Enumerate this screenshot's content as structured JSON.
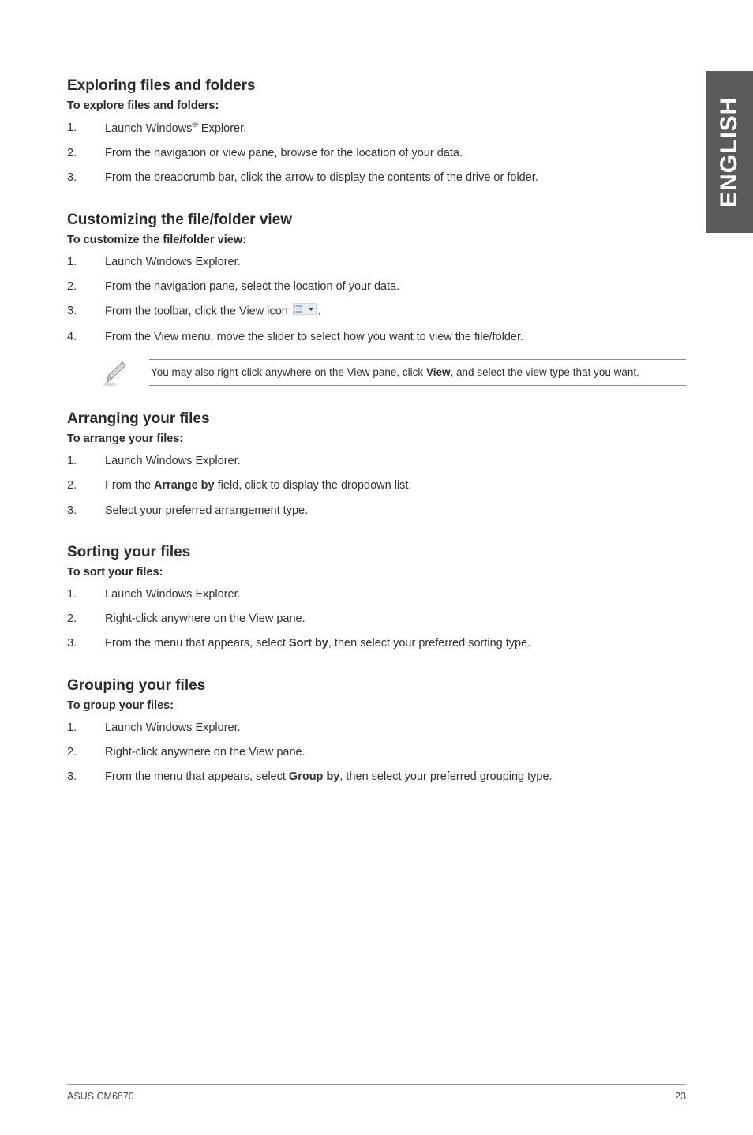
{
  "side_tab": "ENGLISH",
  "sections": {
    "explore": {
      "title": "Exploring files and folders",
      "sub": "To explore files and folders:",
      "items": [
        "Launch Windows® Explorer.",
        "From the navigation or view pane, browse for the location of your data.",
        "From the breadcrumb bar, click the arrow to display the contents of the drive or folder."
      ]
    },
    "customize": {
      "title": "Customizing the file/folder view",
      "sub": "To customize the file/folder view:",
      "items": [
        "Launch Windows Explorer.",
        "From the navigation pane, select the location of your data.",
        "From the toolbar, click the View icon ",
        "From the View menu, move the slider to select how you want to view the file/folder."
      ],
      "item3_suffix": "."
    },
    "note": {
      "pre": "You may also right-click anywhere on the View pane, click ",
      "bold": "View",
      "post": ", and select the view type that you want."
    },
    "arrange": {
      "title": "Arranging your files",
      "sub": "To arrange your files:",
      "items_pre2": "From the ",
      "items_bold2": "Arrange by",
      "items_post2": " field, click to display the dropdown list.",
      "items": [
        "Launch Windows Explorer.",
        "",
        "Select your preferred arrangement type."
      ]
    },
    "sort": {
      "title": "Sorting your files",
      "sub": "To sort your files:",
      "items": [
        "Launch Windows Explorer.",
        "Right-click anywhere on the View pane."
      ],
      "item3_pre": "From the menu that appears, select ",
      "item3_bold": "Sort by",
      "item3_post": ", then select your preferred sorting type."
    },
    "group": {
      "title": "Grouping your files",
      "sub": "To group your files:",
      "items": [
        "Launch Windows Explorer.",
        "Right-click anywhere on the View pane."
      ],
      "item3_pre": "From the menu that appears, select ",
      "item3_bold": "Group by",
      "item3_post": ", then select your preferred grouping type."
    }
  },
  "footer": {
    "left": "ASUS CM6870",
    "right": "23"
  }
}
